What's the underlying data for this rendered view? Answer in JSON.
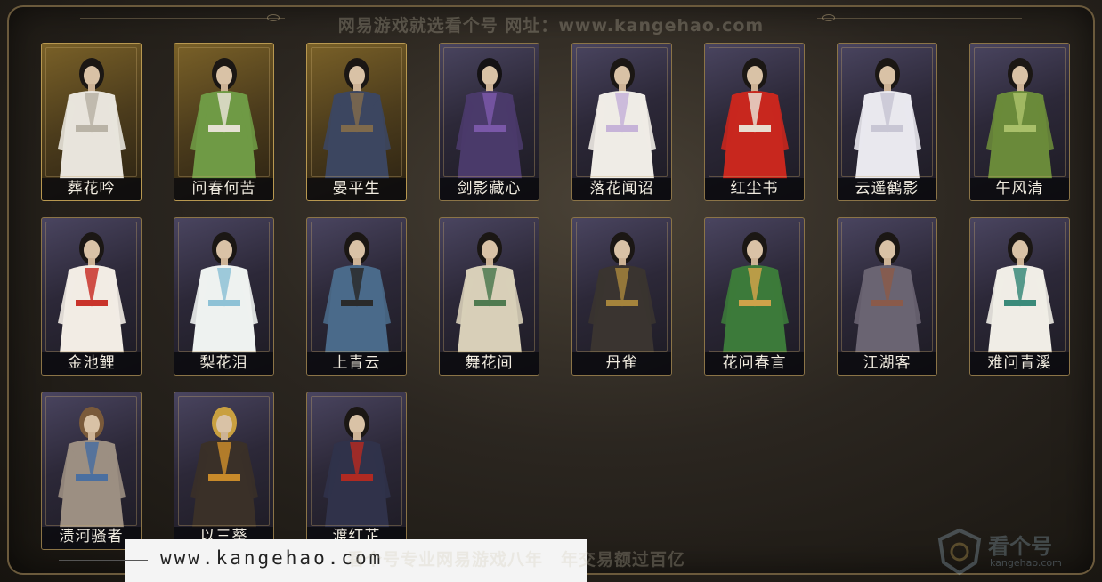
{
  "watermark_top": "网易游戏就选看个号   网址：www.kangehao.com",
  "characters": [
    {
      "name": "葬花吟",
      "style": "gold",
      "robe": "#e8e4dc",
      "accent": "#b9b3a6",
      "hair": "#1b1714"
    },
    {
      "name": "问春何苦",
      "style": "gold",
      "robe": "#6f9a45",
      "accent": "#e6e1d4",
      "hair": "#1b1714"
    },
    {
      "name": "晏平生",
      "style": "gold",
      "robe": "#3c4660",
      "accent": "#7f6a4c",
      "hair": "#1b1714"
    },
    {
      "name": "剑影藏心",
      "style": "purple",
      "robe": "#4a3a6a",
      "accent": "#7a58a8",
      "hair": "#141214"
    },
    {
      "name": "落花闻诏",
      "style": "purple",
      "robe": "#efece6",
      "accent": "#c6b3d8",
      "hair": "#1b1714"
    },
    {
      "name": "红尘书",
      "style": "purple",
      "robe": "#c8271e",
      "accent": "#e8ddd0",
      "hair": "#1b1714"
    },
    {
      "name": "云遥鹤影",
      "style": "purple",
      "robe": "#e9e8ee",
      "accent": "#c8c6d4",
      "hair": "#1b1714"
    },
    {
      "name": "午风清",
      "style": "purple",
      "robe": "#6a8a3a",
      "accent": "#a9c06a",
      "hair": "#1b1714"
    },
    {
      "name": "金池鲤",
      "style": "purple",
      "robe": "#f2ece4",
      "accent": "#c9332a",
      "hair": "#1b1714"
    },
    {
      "name": "梨花泪",
      "style": "purple",
      "robe": "#eef2f0",
      "accent": "#8ec2d6",
      "hair": "#1b1714"
    },
    {
      "name": "上青云",
      "style": "purple",
      "robe": "#4a6a8a",
      "accent": "#2a2a2a",
      "hair": "#1b1714"
    },
    {
      "name": "舞花间",
      "style": "purple",
      "robe": "#d8cfb8",
      "accent": "#4f7a50",
      "hair": "#1b1714"
    },
    {
      "name": "丹雀",
      "style": "purple",
      "robe": "#3a3430",
      "accent": "#a5843c",
      "hair": "#1b1714"
    },
    {
      "name": "花问春言",
      "style": "purple",
      "robe": "#3c7a3a",
      "accent": "#cfa24a",
      "hair": "#1b1714"
    },
    {
      "name": "江湖客",
      "style": "purple",
      "robe": "#6a6472",
      "accent": "#8a5a4a",
      "hair": "#1b1714"
    },
    {
      "name": "难问青溪",
      "style": "purple",
      "robe": "#f0ede6",
      "accent": "#3b8a7a",
      "hair": "#1b1714"
    },
    {
      "name": "渍河骚者",
      "style": "purple",
      "robe": "#9c8f82",
      "accent": "#4a6fa0",
      "hair": "#7a5a3a"
    },
    {
      "name": "以三葵",
      "style": "purple",
      "robe": "#3a3028",
      "accent": "#c88a2a",
      "hair": "#c9a040"
    },
    {
      "name": "渡红芷",
      "style": "purple",
      "robe": "#30324a",
      "accent": "#b02a22",
      "hair": "#1b1714"
    }
  ],
  "banner": {
    "url": "www.kangehao.com"
  },
  "watermark_bottom": {
    "part1": "看个号专业网易游戏八年",
    "part2": "年交易额过百亿"
  },
  "logo": {
    "cn": "看个号",
    "en": "kangehao.com"
  }
}
